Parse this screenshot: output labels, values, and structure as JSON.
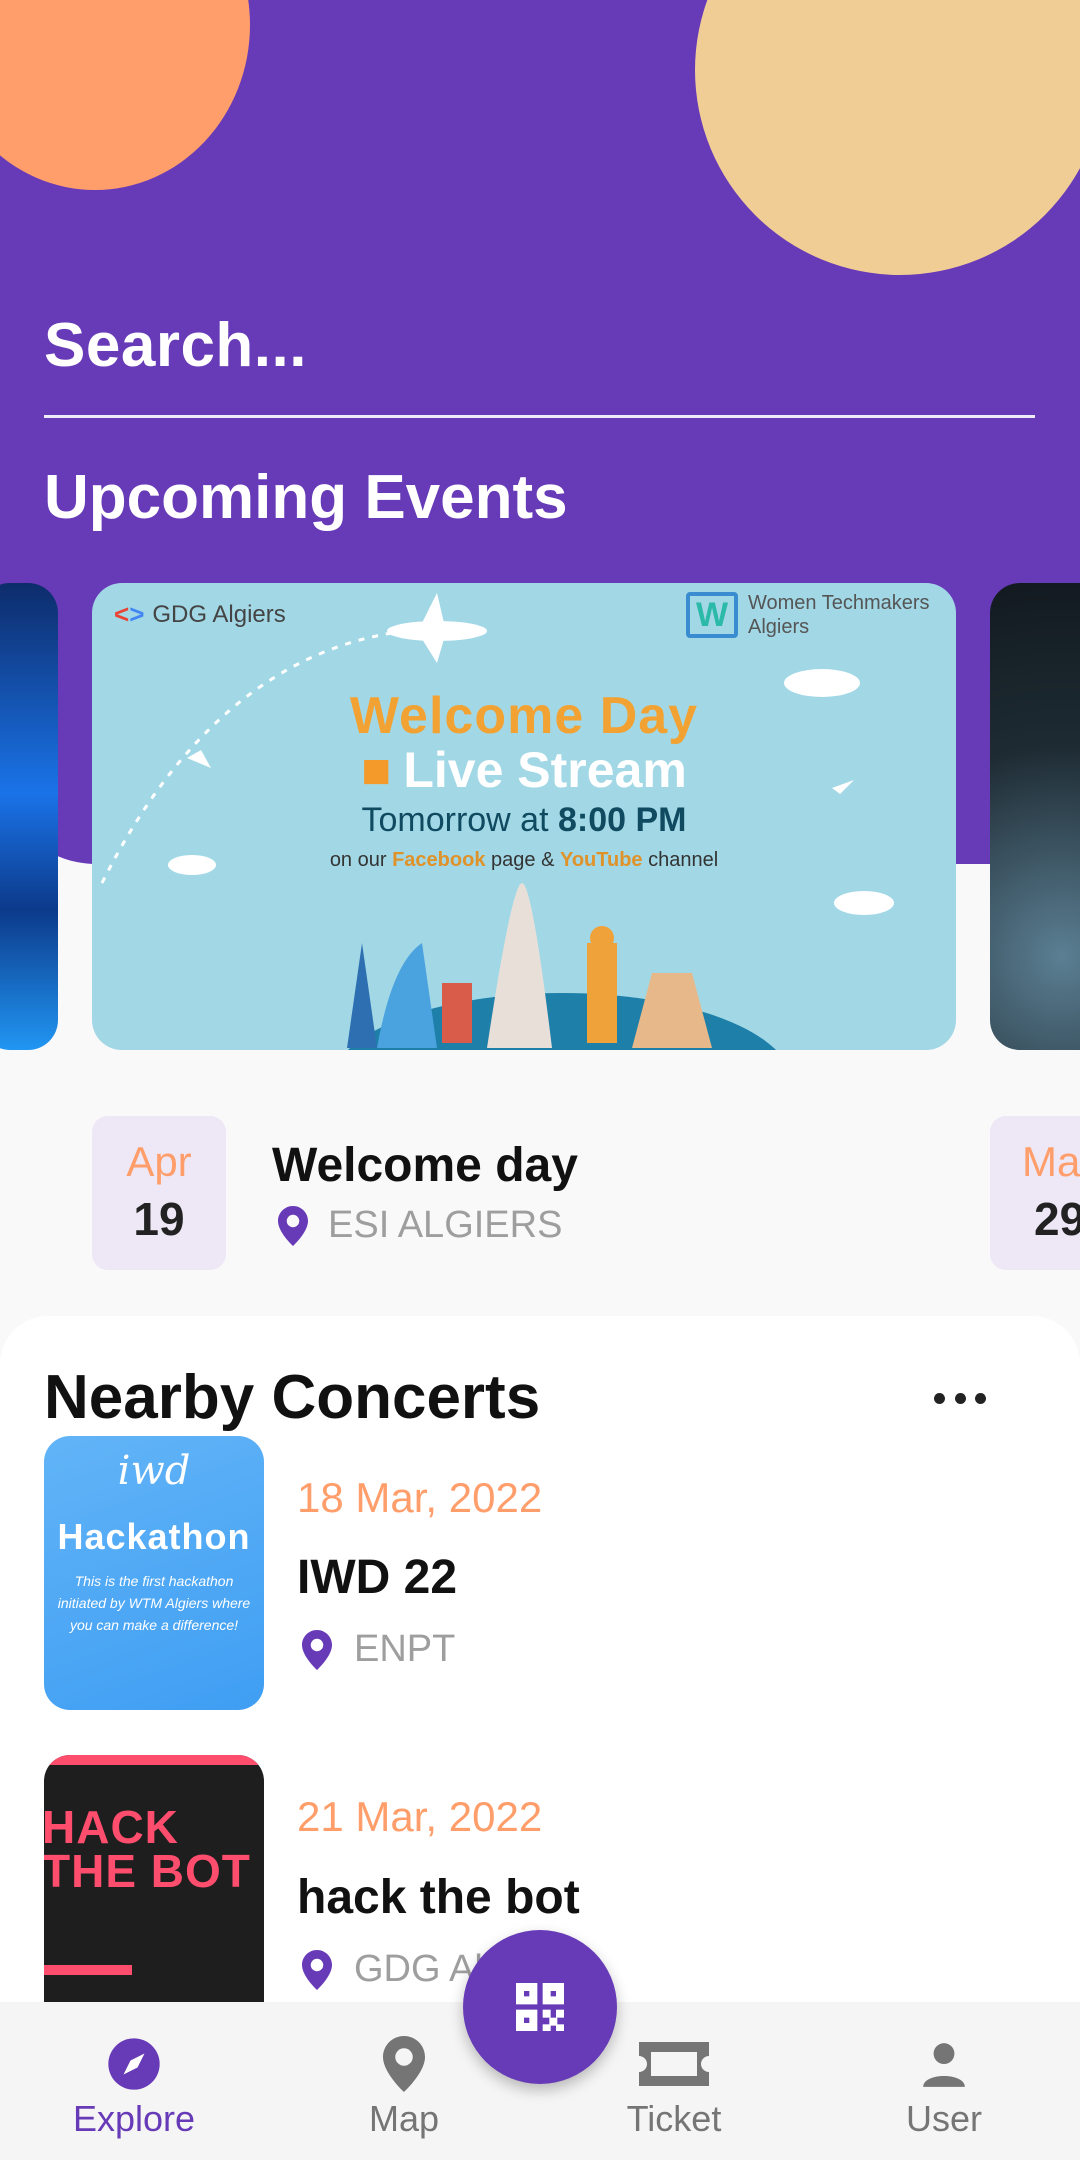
{
  "search": {
    "placeholder": "Search..."
  },
  "upcoming": {
    "title": "Upcoming Events",
    "poster": {
      "org_left": "GDG Algiers",
      "org_right": "Women Techmakers Algiers",
      "headline": "Welcome Day",
      "subheadline": "Live Stream",
      "time_prefix": "Tomorrow at",
      "time": "8:00 PM",
      "channels_prefix": "on our",
      "channel_1": "Facebook",
      "channels_mid": "page &",
      "channel_2": "YouTube",
      "channels_suffix": "channel"
    },
    "event": {
      "month": "Apr",
      "day": "19",
      "name": "Welcome day",
      "location": "ESI ALGIERS"
    },
    "next_event": {
      "month": "Ma",
      "day": "29"
    }
  },
  "nearby": {
    "title": "Nearby Concerts",
    "items": [
      {
        "date": "18 Mar, 2022",
        "name": "IWD 22",
        "location": "ENPT",
        "thumb_line1": "iwd",
        "thumb_line2": "Hackathon",
        "thumb_line3": "This is the first hackathon initiated by WTM Algiers where you can make a difference!"
      },
      {
        "date": "21 Mar, 2022",
        "name": "hack the bot",
        "location": "GDG Al",
        "thumb_line1": "HACK",
        "thumb_line2": "THE BOT"
      }
    ]
  },
  "nav": {
    "items": [
      {
        "label": "Explore",
        "icon": "compass-icon",
        "active": true
      },
      {
        "label": "Map",
        "icon": "map-pin-icon",
        "active": false
      },
      {
        "label": "Ticket",
        "icon": "ticket-icon",
        "active": false
      },
      {
        "label": "User",
        "icon": "user-icon",
        "active": false
      }
    ],
    "fab_icon": "qr-code-icon"
  },
  "colors": {
    "primary": "#673ab7",
    "accent": "#ff9e6a",
    "peach": "#f1cd96",
    "chip": "#ede7f6"
  }
}
